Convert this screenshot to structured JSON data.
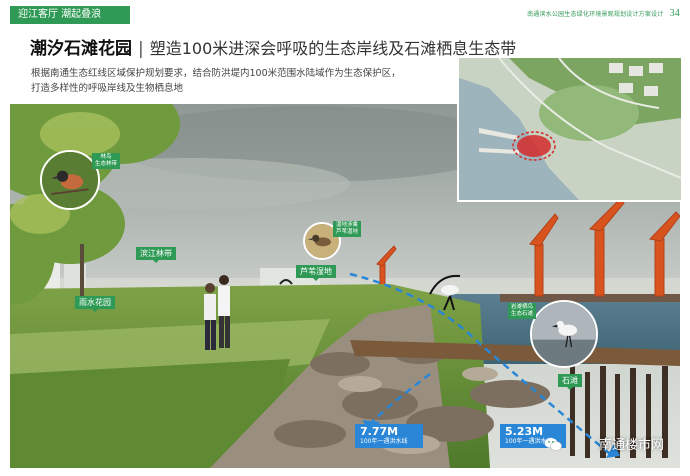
{
  "header": {
    "section_tag": "迎江客厅 潮起叠浪",
    "doc_title": "南通滨水公园生态绿化环境景观规划设计方案设计",
    "page_number": "34"
  },
  "title": {
    "main": "潮汐石滩花园",
    "separator": "|",
    "sub": "塑造100米进深会呼吸的生态岸线及石滩栖息生态带"
  },
  "description": {
    "line1": "根据南通生态红线区域保护规划要求，结合防洪堤内100米范围水陆域作为生态保护区，",
    "line2": "打造多样性的呼吸岸线及生物栖息地"
  },
  "labels": {
    "forest_belt": "滨江林带",
    "rain_garden": "雨水花园",
    "reed_wetland": "芦苇湿地",
    "stone_beach": "石滩",
    "forest_bird_line1": "林鸟",
    "forest_bird_line2": "生态林带",
    "wetland_bird_line1": "湿地涉禽",
    "wetland_bird_line2": "芦苇湿地",
    "beach_bird_line1": "岩滩栖鸟",
    "beach_bird_line2": "生态石滩"
  },
  "flood_lines": [
    {
      "height": "7.77M",
      "caption": "100年一遇洪水线"
    },
    {
      "height": "5.23M",
      "caption": "100年一遇洪水线"
    }
  ],
  "watermark": "南通楼市网",
  "colors": {
    "brand_green": "#2f9a55",
    "flood_blue": "#2a86d6",
    "crane_orange": "#d9531e",
    "map_highlight_red": "#d42a2a"
  }
}
